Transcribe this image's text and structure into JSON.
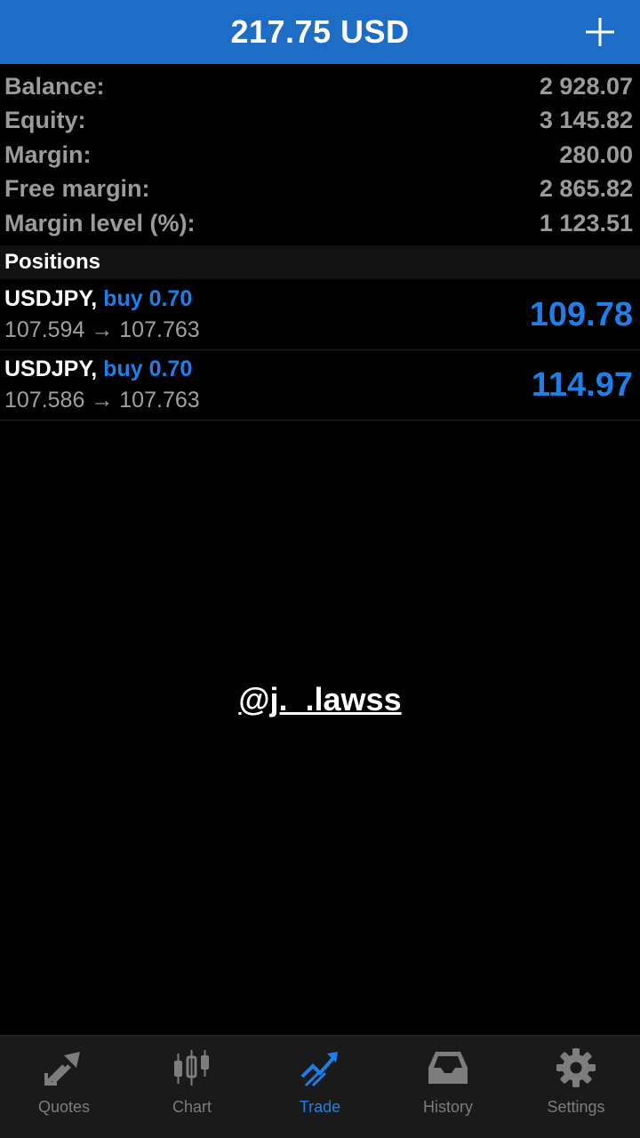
{
  "header": {
    "title": "217.75 USD",
    "add_icon": "plus-icon"
  },
  "summary": [
    {
      "label": "Balance:",
      "value": "2 928.07"
    },
    {
      "label": "Equity:",
      "value": "3 145.82"
    },
    {
      "label": "Margin:",
      "value": "280.00"
    },
    {
      "label": "Free margin:",
      "value": "2 865.82"
    },
    {
      "label": "Margin level (%):",
      "value": "1 123.51"
    }
  ],
  "positions_header": "Positions",
  "positions": [
    {
      "symbol": "USDJPY,",
      "side": "buy 0.70",
      "open_price": "107.594",
      "arrow": "→",
      "current_price": "107.763",
      "profit": "109.78"
    },
    {
      "symbol": "USDJPY,",
      "side": "buy 0.70",
      "open_price": "107.586",
      "arrow": "→",
      "current_price": "107.763",
      "profit": "114.97"
    }
  ],
  "watermark": "@j._.lawss",
  "tabs": [
    {
      "label": "Quotes",
      "icon": "quotes-icon",
      "active": false
    },
    {
      "label": "Chart",
      "icon": "chart-icon",
      "active": false
    },
    {
      "label": "Trade",
      "icon": "trade-icon",
      "active": true
    },
    {
      "label": "History",
      "icon": "history-icon",
      "active": false
    },
    {
      "label": "Settings",
      "icon": "settings-icon",
      "active": false
    }
  ],
  "colors": {
    "header_bg": "#1d6cc6",
    "accent": "#1f7fe8",
    "label_gray": "#9b9b9b",
    "tabbar_bg": "#1a1a1a"
  }
}
